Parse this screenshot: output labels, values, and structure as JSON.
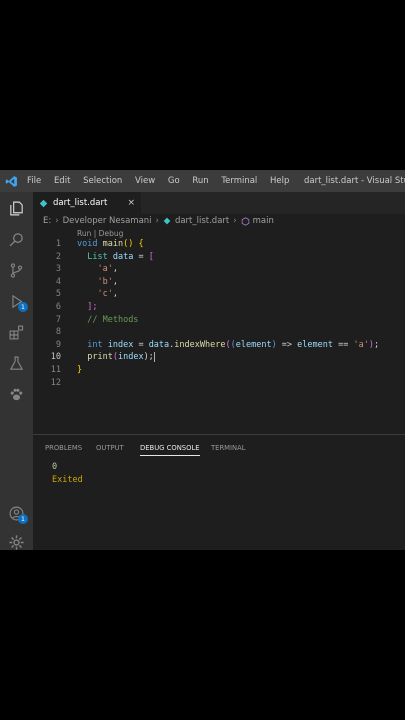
{
  "menu": [
    "File",
    "Edit",
    "Selection",
    "View",
    "Go",
    "Run",
    "Terminal",
    "Help"
  ],
  "window_title": "dart_list.dart - Visual Studio C",
  "tab": {
    "label": "dart_list.dart"
  },
  "breadcrumbs": {
    "root": "E:",
    "folder": "Developer Nesamani",
    "file": "dart_list.dart",
    "symbol": "main"
  },
  "codelens": "Run | Debug",
  "line_numbers": [
    "1",
    "2",
    "3",
    "4",
    "5",
    "6",
    "7",
    "8",
    "9",
    "10",
    "11",
    "12"
  ],
  "code": {
    "l1": [
      "void",
      "main",
      "()",
      " {"
    ],
    "l2": [
      "List",
      "data",
      " = ",
      "["
    ],
    "l3": [
      "'a'",
      ","
    ],
    "l4": [
      "'b'",
      ","
    ],
    "l5": [
      "'c'",
      ","
    ],
    "l6": [
      "];"
    ],
    "l7": [
      "// Methods"
    ],
    "l9": [
      "int",
      "index",
      " = ",
      "data",
      ".",
      "indexWhere",
      "(",
      "(",
      "element",
      ")",
      " => ",
      "element",
      " == ",
      "'a'",
      ")",
      ";"
    ],
    "l10": [
      "print",
      "(",
      "index",
      ");"
    ],
    "l11": [
      "}"
    ]
  },
  "panel": {
    "tabs": [
      "PROBLEMS",
      "OUTPUT",
      "DEBUG CONSOLE",
      "TERMINAL"
    ],
    "output": [
      "0",
      "Exited"
    ]
  },
  "badges": {
    "run": "1",
    "accounts": "1"
  },
  "colors": {
    "accent": "#0e70c0",
    "keyword": "#569cd6",
    "string": "#ce9178",
    "comment": "#6a9955"
  }
}
